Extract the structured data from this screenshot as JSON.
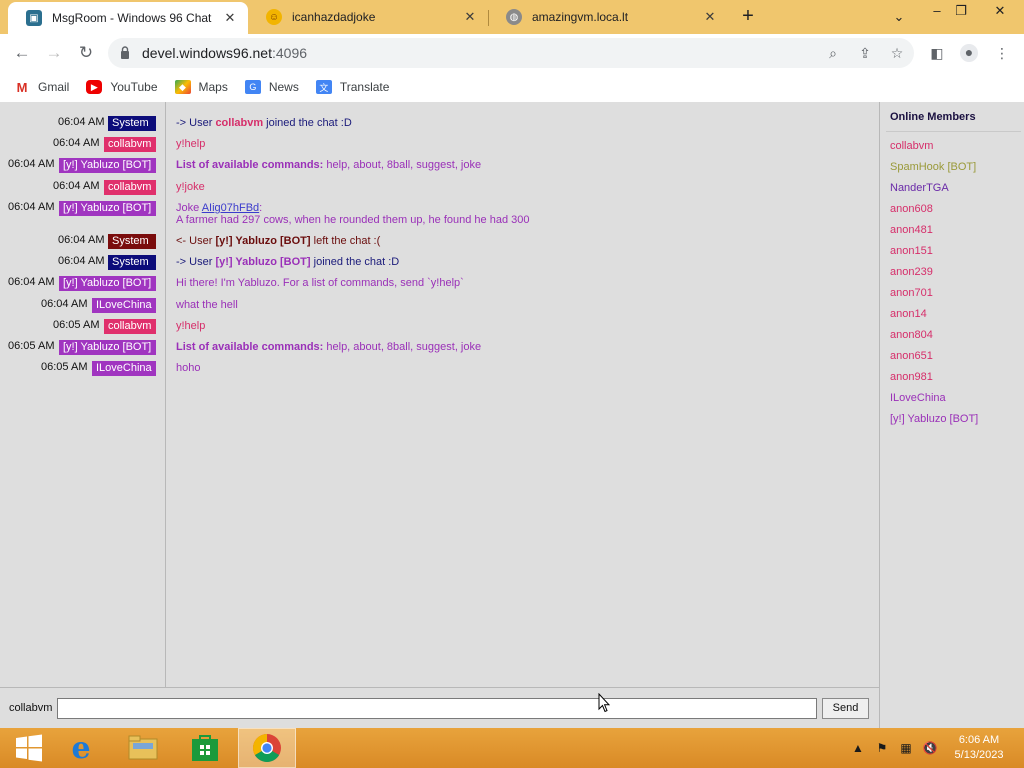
{
  "browser": {
    "tabs": [
      {
        "title": "MsgRoom - Windows 96 Chat",
        "active": true
      },
      {
        "title": "icanhazdadjoke",
        "active": false
      },
      {
        "title": "amazingvm.loca.lt",
        "active": false
      }
    ],
    "url_host": "devel.windows96.net",
    "url_port": ":4096",
    "bookmarks": [
      "Gmail",
      "YouTube",
      "Maps",
      "News",
      "Translate"
    ]
  },
  "chat": {
    "messages": [
      {
        "time": "06:04 AM",
        "user": "System",
        "kind": "system",
        "parts": [
          "-> User ",
          "collabvm",
          " joined the chat :D"
        ]
      },
      {
        "time": "06:04 AM",
        "user": "collabvm",
        "kind": "collab",
        "text": "y!help"
      },
      {
        "time": "06:04 AM",
        "user": "[y!] Yabluzo [BOT]",
        "kind": "bot",
        "bold": "List of available commands:",
        "text": " help, about, 8ball, suggest, joke"
      },
      {
        "time": "06:04 AM",
        "user": "collabvm",
        "kind": "collab",
        "text": "y!joke"
      },
      {
        "time": "06:04 AM",
        "user": "[y!] Yabluzo [BOT]",
        "kind": "bot",
        "prefix": "Joke ",
        "link": "AIig07hFBd",
        "suffix": ":",
        "line2": "A farmer had 297 cows, when he rounded them up, he found he had 300"
      },
      {
        "time": "06:04 AM",
        "user": "System",
        "kind": "system-red",
        "parts": [
          "<- User ",
          "[y!] Yabluzo [BOT]",
          " left the chat :("
        ]
      },
      {
        "time": "06:04 AM",
        "user": "System",
        "kind": "system",
        "parts": [
          "-> User ",
          "[y!] Yabluzo [BOT]",
          " joined the chat :D"
        ]
      },
      {
        "time": "06:04 AM",
        "user": "[y!] Yabluzo [BOT]",
        "kind": "bot",
        "text": "Hi there! I'm Yabluzo. For a list of commands, send `y!help`"
      },
      {
        "time": "06:04 AM",
        "user": "ILoveChina",
        "kind": "ilove",
        "text": "what the hell"
      },
      {
        "time": "06:05 AM",
        "user": "collabvm",
        "kind": "collab",
        "text": "y!help"
      },
      {
        "time": "06:05 AM",
        "user": "[y!] Yabluzo [BOT]",
        "kind": "bot",
        "bold": "List of available commands:",
        "text": " help, about, 8ball, suggest, joke"
      },
      {
        "time": "06:05 AM",
        "user": "ILoveChina",
        "kind": "ilove",
        "text": "hoho"
      }
    ],
    "input_nick": "collabvm",
    "input_value": "",
    "send_label": "Send"
  },
  "members": {
    "title": "Online Members",
    "list": [
      {
        "name": "collabvm",
        "color": "#d62e6a"
      },
      {
        "name": "SpamHook [BOT]",
        "color": "#9a9a3a"
      },
      {
        "name": "NanderTGA",
        "color": "#6a2aa8"
      },
      {
        "name": "anon608",
        "color": "#d62e6a"
      },
      {
        "name": "anon481",
        "color": "#d62e6a"
      },
      {
        "name": "anon151",
        "color": "#d62e6a"
      },
      {
        "name": "anon239",
        "color": "#d62e6a"
      },
      {
        "name": "anon701",
        "color": "#d62e6a"
      },
      {
        "name": "anon14",
        "color": "#d62e6a"
      },
      {
        "name": "anon804",
        "color": "#d62e6a"
      },
      {
        "name": "anon651",
        "color": "#d62e6a"
      },
      {
        "name": "anon981",
        "color": "#d62e6a"
      },
      {
        "name": "ILoveChina",
        "color": "#9a30b8"
      },
      {
        "name": "[y!] Yabluzo [BOT]",
        "color": "#9a30b8"
      }
    ]
  },
  "taskbar": {
    "time": "6:06 AM",
    "date": "5/13/2023"
  }
}
